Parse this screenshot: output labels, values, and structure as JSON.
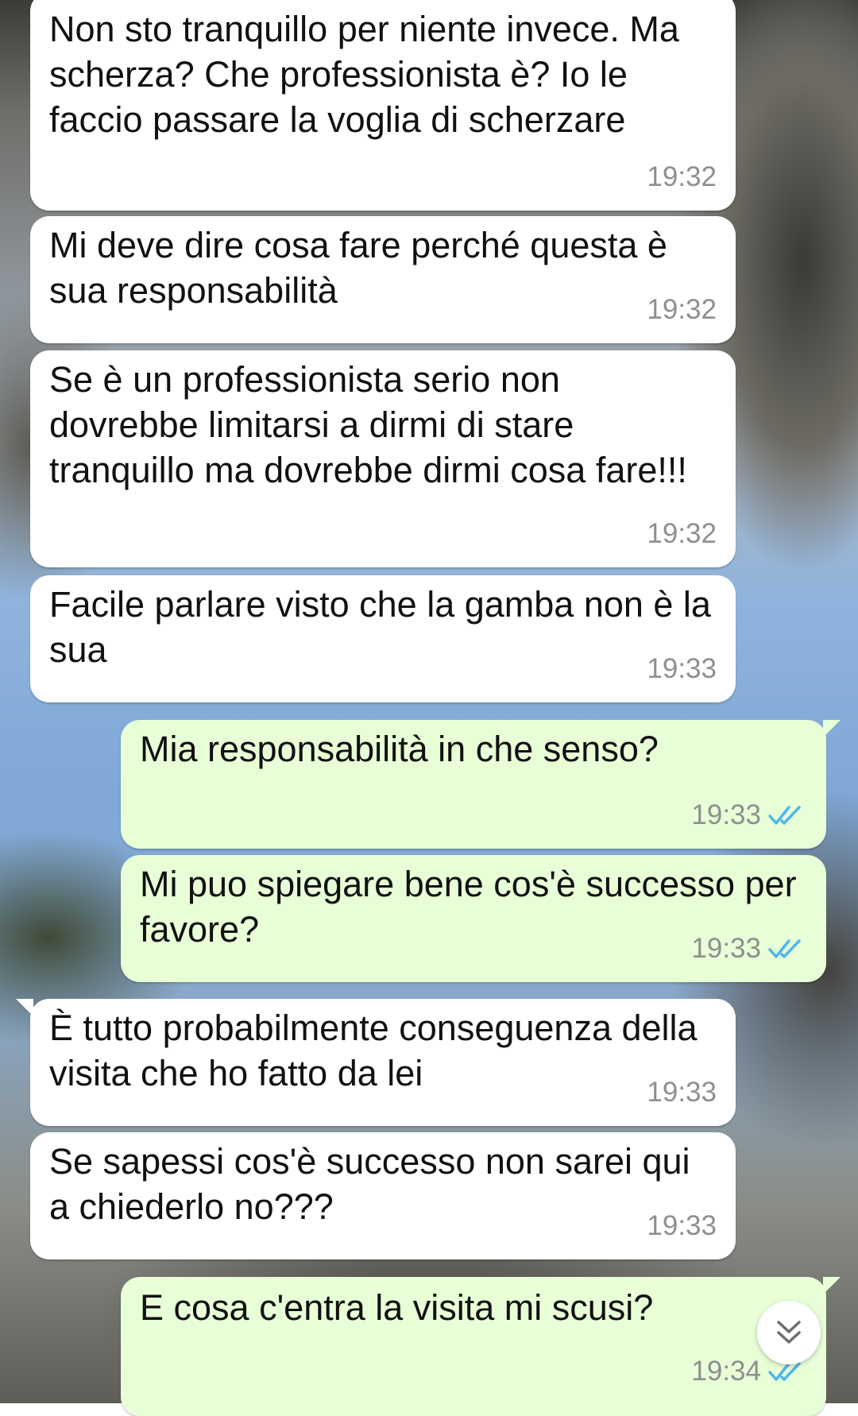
{
  "messages": [
    {
      "direction": "in",
      "text": "Non sto tranquillo per niente invece. Ma scherza? Che professionista è? Io le faccio passare la voglia di scherzare",
      "time": "19:32"
    },
    {
      "direction": "in",
      "text": "Mi deve dire cosa fare perché questa è sua responsabilità",
      "time": "19:32"
    },
    {
      "direction": "in",
      "text": "Se è un professionista serio non dovrebbe limitarsi a dirmi di stare tranquillo ma dovrebbe dirmi cosa fare!!!",
      "time": "19:32"
    },
    {
      "direction": "in",
      "text": "Facile parlare visto che la gamba non è la sua",
      "time": "19:33"
    },
    {
      "direction": "out",
      "text": "Mia responsabilità in che senso?",
      "time": "19:33",
      "status": "read"
    },
    {
      "direction": "out",
      "text": "Mi puo spiegare bene cos'è successo per favore?",
      "time": "19:33",
      "status": "read"
    },
    {
      "direction": "in",
      "text": "È tutto probabilmente conseguenza della visita che ho fatto da lei",
      "time": "19:33"
    },
    {
      "direction": "in",
      "text": "Se sapessi cos'è successo non sarei qui a chiederlo no???",
      "time": "19:33"
    },
    {
      "direction": "out",
      "text": "E cosa c'entra la visita mi scusi?",
      "time": "19:34",
      "status": "read"
    }
  ],
  "colors": {
    "incoming_bubble": "#ffffff",
    "outgoing_bubble": "#e7fed7",
    "read_ticks": "#4fb6ec",
    "timestamp": "#8d8f90"
  },
  "icons": {
    "read_receipt": "double-check-icon",
    "scroll_down": "chevron-double-down-icon"
  }
}
